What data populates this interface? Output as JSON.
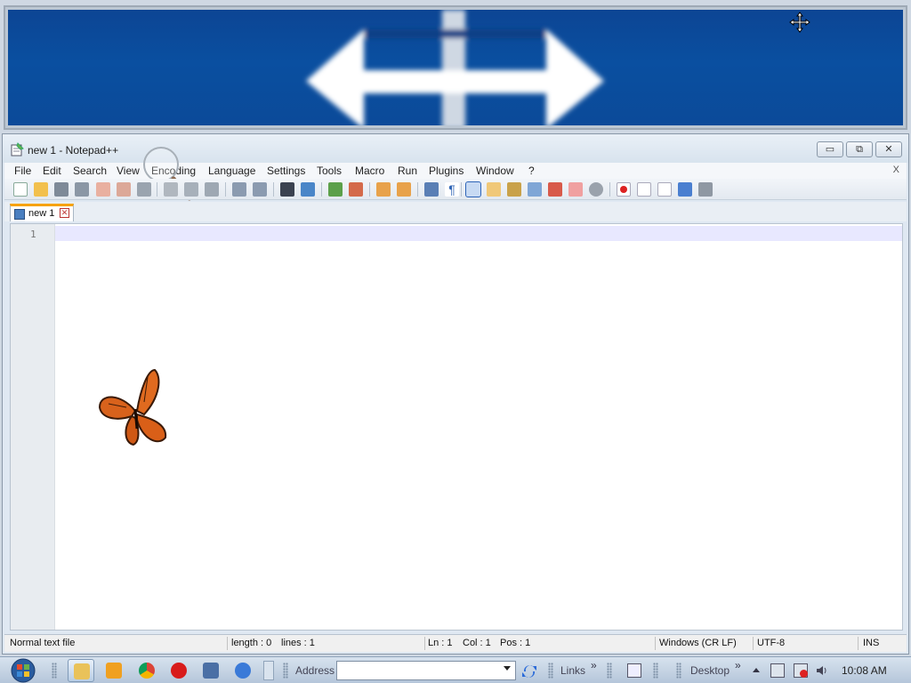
{
  "magnifier": {},
  "window": {
    "title": "new 1 - Notepad++",
    "controls": {
      "minimize": "▭",
      "maximize": "⧉",
      "close": "✕"
    }
  },
  "menu": {
    "items": [
      "File",
      "Edit",
      "Search",
      "View",
      "Encoding",
      "Language",
      "Settings",
      "Tools",
      "Macro",
      "Run",
      "Plugins",
      "Window",
      "?"
    ],
    "close_doc": "X"
  },
  "toolbar": {
    "icons": [
      "new-file-icon",
      "open-file-icon",
      "save-icon",
      "save-all-icon",
      "close-icon",
      "close-all-icon",
      "print-icon",
      "cut-icon",
      "copy-icon",
      "paste-icon",
      "undo-icon",
      "redo-icon",
      "find-icon",
      "replace-icon",
      "zoom-in-icon",
      "zoom-out-icon",
      "sync-v-icon",
      "sync-h-icon",
      "word-wrap-icon",
      "show-all-chars-icon",
      "indent-guide-icon",
      "lang-udl-icon",
      "doc-map-icon",
      "function-list-icon",
      "folder-workspace-icon",
      "monitoring-icon",
      "macro-record-icon",
      "macro-stop-icon",
      "macro-play-icon",
      "macro-run-multiple-icon",
      "macro-save-icon"
    ]
  },
  "tabs": [
    {
      "label": "new 1"
    }
  ],
  "editor": {
    "line_numbers": [
      "1"
    ]
  },
  "status": {
    "file_type": "Normal text file",
    "length": "length : 0",
    "lines": "lines : 1",
    "ln": "Ln : 1",
    "col": "Col : 1",
    "pos": "Pos : 1",
    "eol": "Windows (CR LF)",
    "encoding": "UTF-8",
    "mode": "INS"
  },
  "taskbar": {
    "address_label": "Address",
    "address_value": "",
    "links_label": "Links",
    "desktop_label": "Desktop",
    "chevron": "»",
    "clock": "10:08 AM"
  },
  "colors": {
    "magnifier_blue": "#0b4a99",
    "tab_accent": "#f6a200",
    "current_line": "#e8e8ff"
  }
}
